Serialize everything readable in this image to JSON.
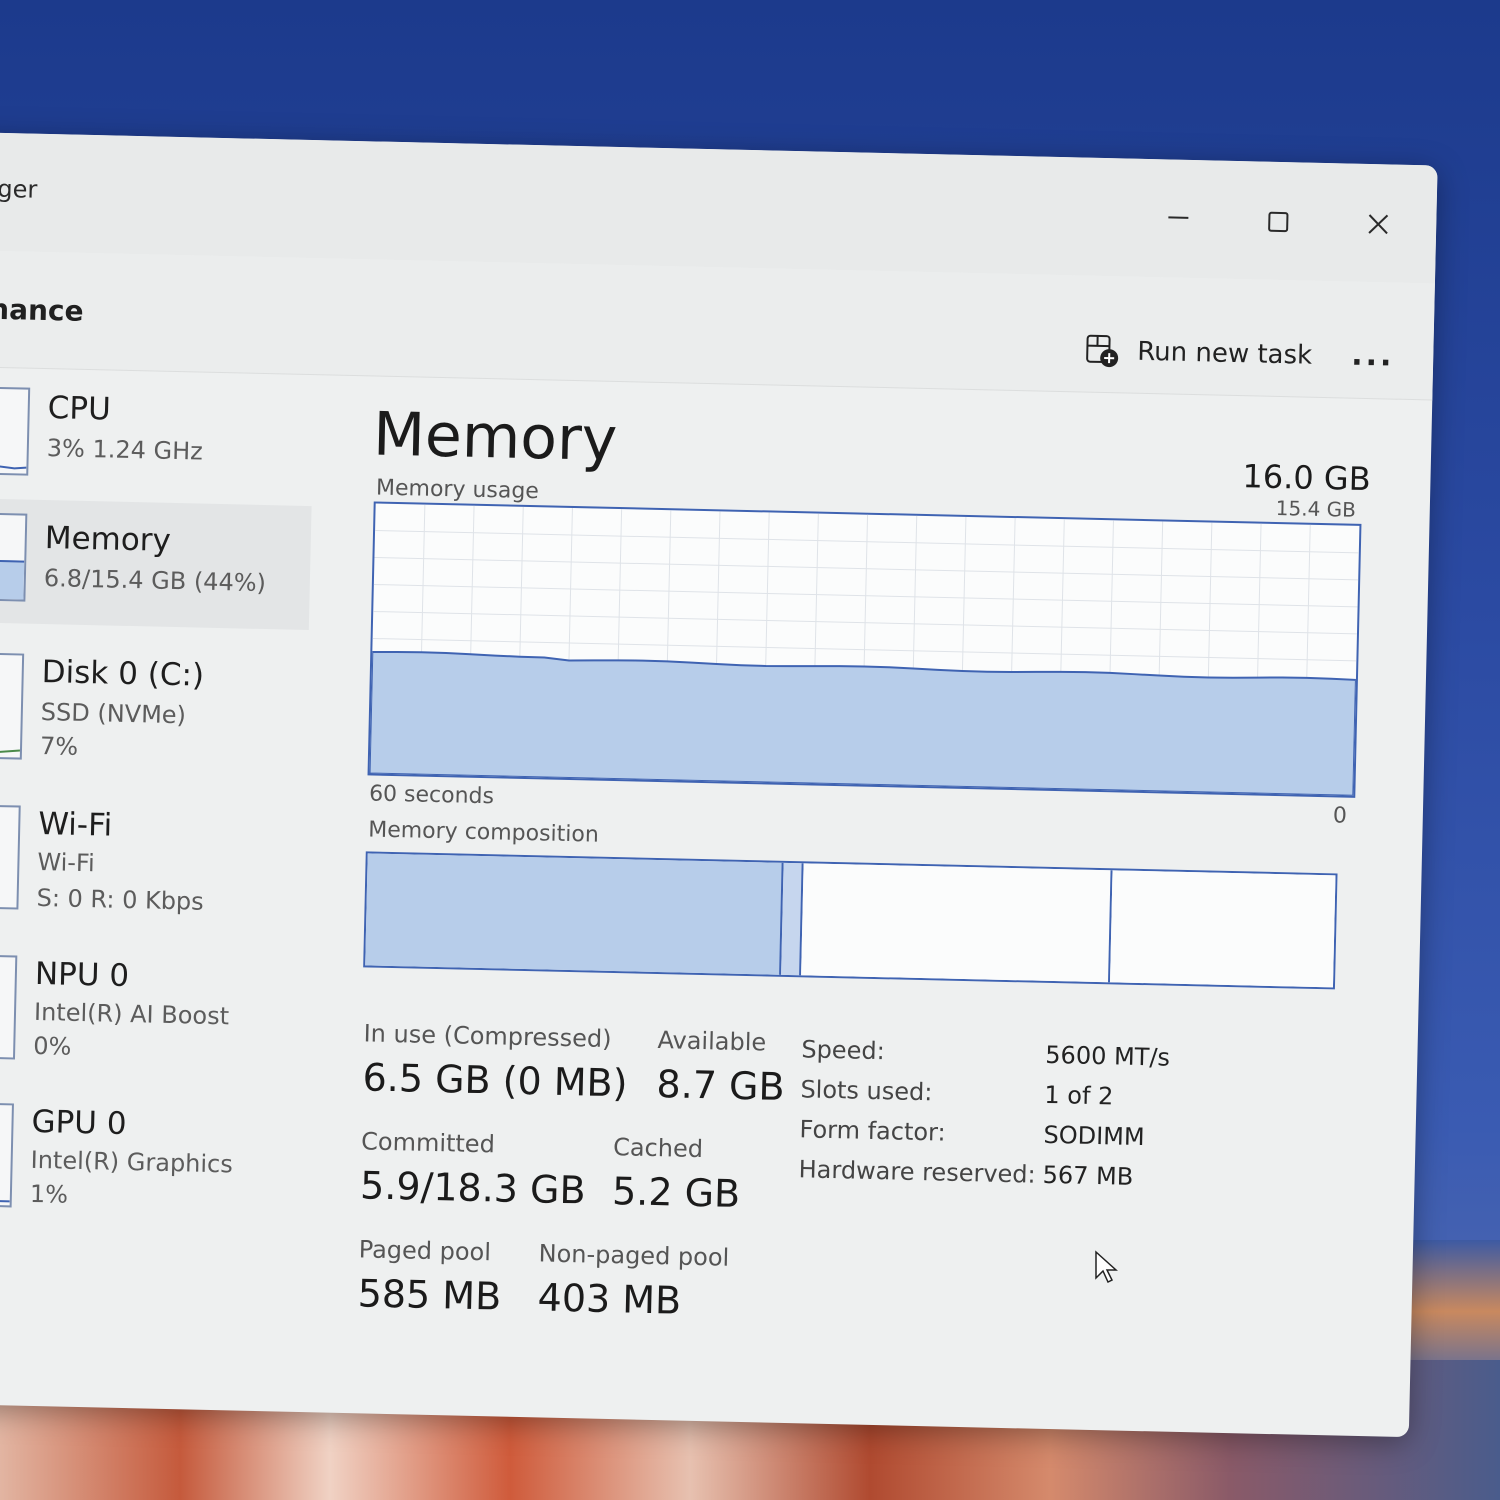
{
  "window": {
    "title": "ager",
    "section": "mance",
    "toolbar": {
      "run_new_task": "Run new task",
      "more": "..."
    }
  },
  "sidebar": {
    "items": [
      {
        "name": "CPU",
        "sub1": "3%  1.24 GHz",
        "sub2": ""
      },
      {
        "name": "Memory",
        "sub1": "6.8/15.4 GB (44%)",
        "sub2": ""
      },
      {
        "name": "Disk 0 (C:)",
        "sub1": "SSD (NVMe)",
        "sub2": "7%"
      },
      {
        "name": "Wi-Fi",
        "sub1": "Wi-Fi",
        "sub2": "S: 0 R: 0 Kbps"
      },
      {
        "name": "NPU 0",
        "sub1": "Intel(R) AI Boost",
        "sub2": "0%"
      },
      {
        "name": "GPU 0",
        "sub1": "Intel(R) Graphics",
        "sub2": "1%"
      }
    ]
  },
  "main": {
    "heading": "Memory",
    "total": "16.0 GB",
    "usage_label": "Memory usage",
    "usage_max": "15.4 GB",
    "time_span": "60 seconds",
    "usage_min": "0",
    "composition_label": "Memory composition",
    "usage_fraction": 0.44,
    "composition_fractions": [
      0.43,
      0.02,
      0.32,
      0.23
    ],
    "stats": {
      "in_use_label": "In use (Compressed)",
      "in_use_value": "6.5 GB (0 MB)",
      "available_label": "Available",
      "available_value": "8.7 GB",
      "committed_label": "Committed",
      "committed_value": "5.9/18.3 GB",
      "cached_label": "Cached",
      "cached_value": "5.2 GB",
      "paged_label": "Paged pool",
      "paged_value": "585 MB",
      "nonpaged_label": "Non-paged pool",
      "nonpaged_value": "403 MB"
    },
    "specs": {
      "speed_label": "Speed:",
      "speed_value": "5600 MT/s",
      "slots_label": "Slots used:",
      "slots_value": "1 of 2",
      "form_label": "Form factor:",
      "form_value": "SODIMM",
      "reserved_label": "Hardware reserved:",
      "reserved_value": "567 MB"
    }
  },
  "colors": {
    "accent": "#3f63b2",
    "fill": "#b7cdea",
    "window_bg": "#eef0f0"
  }
}
